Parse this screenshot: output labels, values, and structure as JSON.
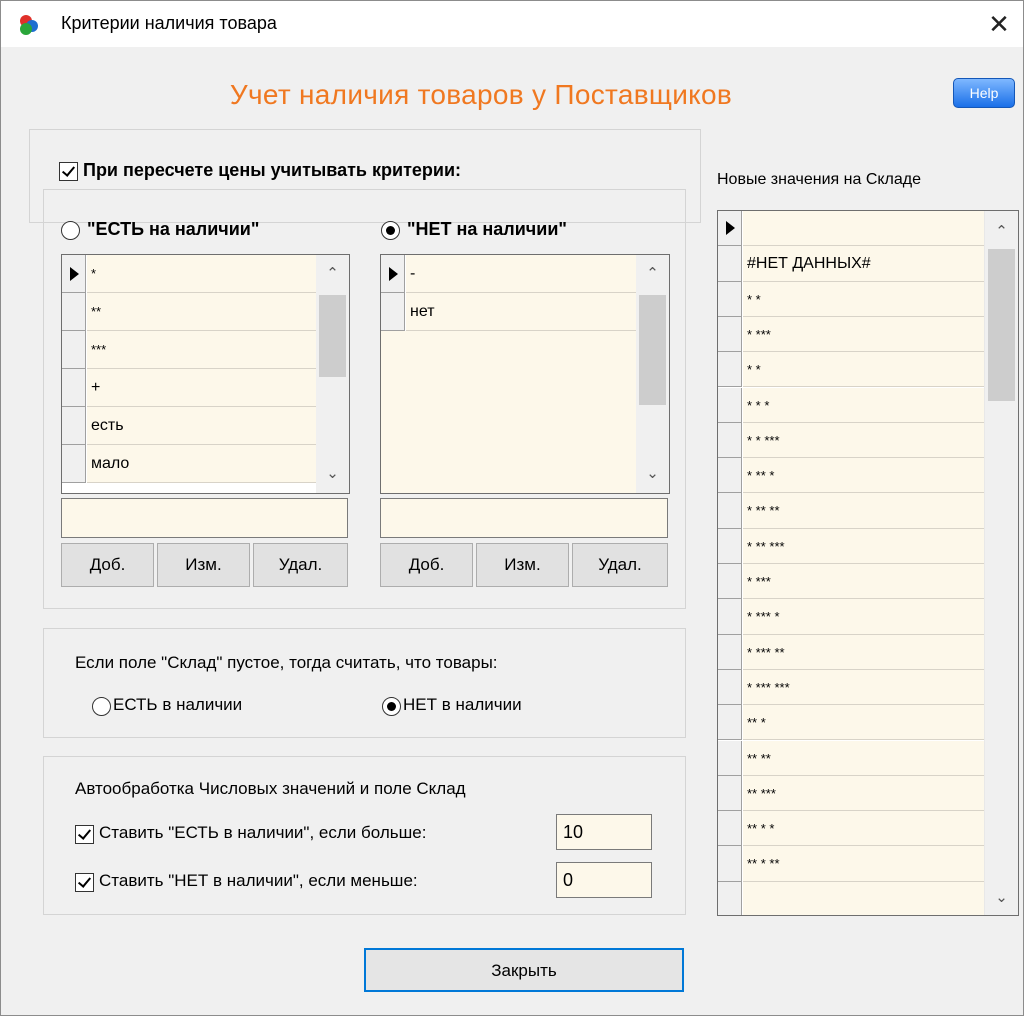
{
  "window": {
    "title": "Критерии наличия товара",
    "close": "✕"
  },
  "heading": "Учет наличия товаров у Поставщиков",
  "help_label": "Help",
  "criteria": {
    "checkbox_label": "При пересчете цены учитывать критерии:",
    "checked": true,
    "yes_radio": "\"ЕСТЬ на наличии\"",
    "no_radio": "\"НЕТ на наличии\"",
    "selected": "no",
    "yes_list": [
      "*",
      "**",
      "***",
      "+",
      "есть",
      "мало"
    ],
    "no_list": [
      "-",
      "нет"
    ],
    "yes_input": "",
    "no_input": "",
    "add_label": "Доб.",
    "edit_label": "Изм.",
    "delete_label": "Удал."
  },
  "empty_field": {
    "label": "Если поле \"Склад\" пустое, тогда считать, что товары:",
    "yes_option": "ЕСТЬ в наличии",
    "no_option": "НЕТ в наличии",
    "selected": "no"
  },
  "auto": {
    "label": "Автообработка Числовых значений и поле Склад",
    "yes_rule": "Ставить \"ЕСТЬ в наличии\", если больше:",
    "yes_value": "10",
    "no_rule": "Ставить \"НЕТ в наличии\", если меньше:",
    "no_value": "0"
  },
  "stock": {
    "label": "Новые значения на Складе",
    "values": [
      "",
      "#НЕТ ДАННЫХ#",
      "*  *",
      "*  ***",
      "* *",
      "* * *",
      "* * ***",
      "* ** *",
      "* ** **",
      "* ** ***",
      "* ***",
      "* *** *",
      "* *** **",
      "* *** ***",
      "**  *",
      "**  **",
      "**  ***",
      "** * *",
      "** * **",
      ""
    ]
  },
  "close_label": "Закрыть",
  "colors": {
    "heading": "#f07820",
    "cell_bg": "#fdf8ea",
    "help_button": "#1a6fe8"
  }
}
